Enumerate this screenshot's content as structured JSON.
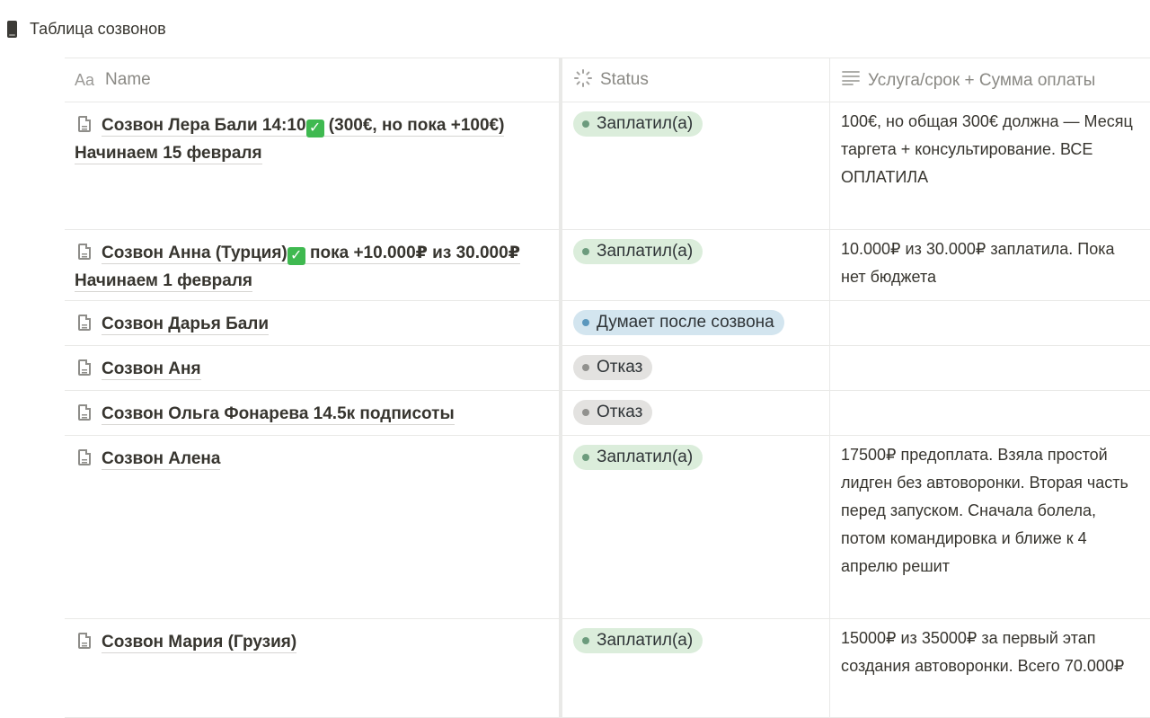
{
  "database": {
    "title": "Таблица созвонов",
    "icon": "document-icon"
  },
  "columns": {
    "name": {
      "prefix": "Aa",
      "label": "Name"
    },
    "status": {
      "icon": "status-loading-icon",
      "label": "Status"
    },
    "note": {
      "icon": "text-lines-icon",
      "label": "Услуга/срок + Сумма оплаты"
    }
  },
  "status_colors": {
    "paid": "#dbeddb",
    "thinking": "#d3e5ef",
    "refused": "#e3e2e0"
  },
  "rows": [
    {
      "name_part1": "Созвон Лера Бали 14:10",
      "check": true,
      "name_part2": " (300€, но пока +100€)",
      "name_line2": "Начинаем 15 февраля",
      "status": "Заплатил(а)",
      "status_type": "green",
      "note": "100€, но общая 300€ должна — Месяц таргета + консультирование. ВСЕ ОПЛАТИЛА"
    },
    {
      "name_part1": "Созвон Анна (Турция)",
      "check": true,
      "name_part2": " пока +10.000₽ из 30.000₽",
      "name_line2": "Начинаем 1 февраля",
      "status": "Заплатил(а)",
      "status_type": "green",
      "note": "10.000₽ из 30.000₽ заплатила. Пока нет бюджета"
    },
    {
      "name_part1": "Созвон Дарья Бали",
      "check": false,
      "name_part2": "",
      "name_line2": "",
      "status": "Думает после созвона",
      "status_type": "blue",
      "note": ""
    },
    {
      "name_part1": "Созвон Аня",
      "check": false,
      "name_part2": "",
      "name_line2": "",
      "status": "Отказ",
      "status_type": "gray",
      "note": ""
    },
    {
      "name_part1": "Созвон Ольга Фонарева 14.5к подписоты",
      "check": false,
      "name_part2": "",
      "name_line2": "",
      "status": "Отказ",
      "status_type": "gray",
      "note": ""
    },
    {
      "name_part1": "Созвон Алена",
      "check": false,
      "name_part2": "",
      "name_line2": "",
      "status": "Заплатил(а)",
      "status_type": "green",
      "note": "17500₽ предоплата. Взяла простой лидген без автоворонки. Вторая часть перед запуском. Сначала болела, потом командировка и ближе к 4 апрелю решит"
    },
    {
      "name_part1": "Созвон Мария (Грузия)",
      "check": false,
      "name_part2": "",
      "name_line2": "",
      "status": "Заплатил(а)",
      "status_type": "green",
      "note": "15000₽ из 35000₽ за первый этап создания автоворонки. Всего 70.000₽"
    }
  ]
}
